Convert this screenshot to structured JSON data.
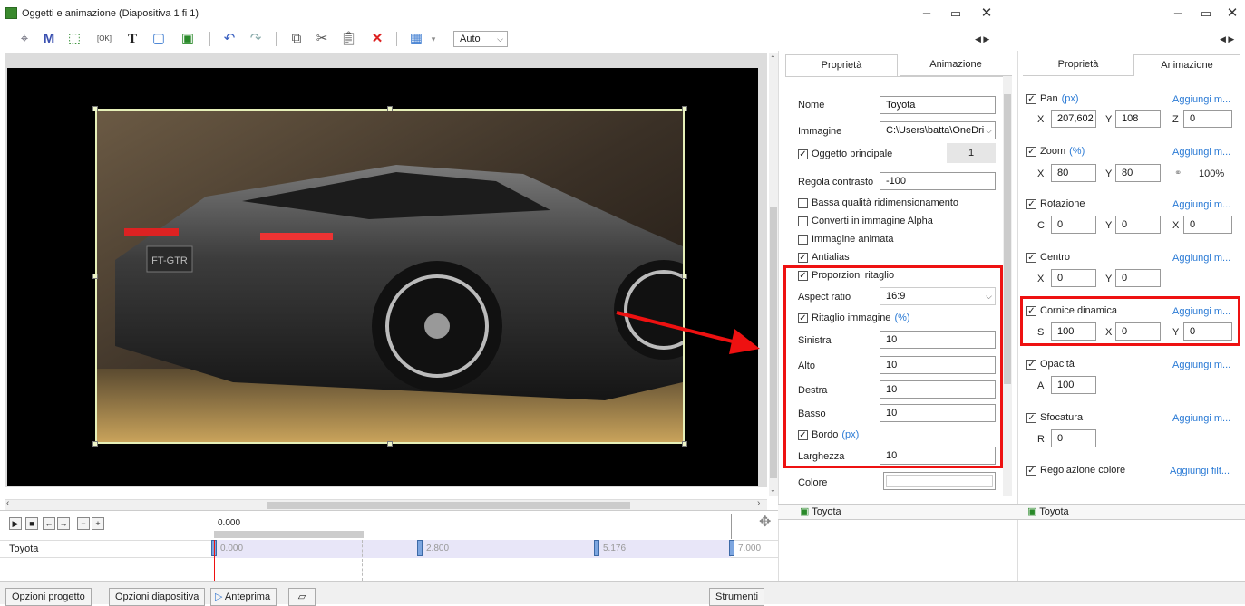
{
  "window": {
    "title": "Oggetti e animazione (Diapositiva 1 fi 1)"
  },
  "toolbar": {
    "zoom": "Auto"
  },
  "left_panel": {
    "tabs": [
      "Proprietà",
      "Animazione"
    ],
    "nome_label": "Nome",
    "nome_value": "Toyota",
    "immagine_label": "Immagine",
    "immagine_value": "C:\\Users\\batta\\OneDri",
    "oggetto_principale": "Oggetto principale",
    "oggetto_value": "1",
    "contrasto_label": "Regola contrasto",
    "contrasto_value": "-100",
    "bassa_qualita": "Bassa qualità ridimensionamento",
    "converti_alpha": "Converti in immagine Alpha",
    "immagine_animata": "Immagine animata",
    "antialias": "Antialias",
    "proporzioni": "Proporzioni ritaglio",
    "aspect_label": "Aspect ratio",
    "aspect_value": "16:9",
    "ritaglio_label": "Ritaglio immagine",
    "ritaglio_unit": "(%)",
    "sinistra_label": "Sinistra",
    "sinistra_value": "10",
    "alto_label": "Alto",
    "alto_value": "10",
    "destra_label": "Destra",
    "destra_value": "10",
    "basso_label": "Basso",
    "basso_value": "10",
    "bordo_label": "Bordo",
    "bordo_unit": "(px)",
    "larghezza_label": "Larghezza",
    "larghezza_value": "10",
    "colore_label": "Colore",
    "object_name": "Toyota"
  },
  "right_panel": {
    "tabs": [
      "Proprietà",
      "Animazione"
    ],
    "add_label": "Aggiungi m...",
    "add_filter": "Aggiungi filt...",
    "pan": "Pan",
    "pan_unit": "(px)",
    "pan_x": "207,602",
    "pan_y": "108",
    "pan_z": "0",
    "zoom": "Zoom",
    "zoom_unit": "(%)",
    "zoom_x": "80",
    "zoom_y": "80",
    "zoom_pct": "100%",
    "rotazione": "Rotazione",
    "rot_c": "0",
    "rot_y": "0",
    "rot_x": "0",
    "centro": "Centro",
    "centro_x": "0",
    "centro_y": "0",
    "cornice": "Cornice dinamica",
    "cornice_s": "100",
    "cornice_x": "0",
    "cornice_y": "0",
    "opacita": "Opacità",
    "opacita_a": "100",
    "sfocatura": "Sfocatura",
    "sfocatura_r": "0",
    "regolazione": "Regolazione colore",
    "object_name": "Toyota",
    "letters": {
      "x": "X",
      "y": "Y",
      "z": "Z",
      "c": "C",
      "s": "S",
      "a": "A",
      "r": "R"
    }
  },
  "timeline": {
    "time": "0.000",
    "track": "Toyota",
    "marks": [
      "0.000",
      "2.800",
      "5.176",
      "7.000"
    ]
  },
  "bottom": {
    "opzioni_progetto": "Opzioni progetto",
    "opzioni_diapositiva": "Opzioni diapositiva",
    "anteprima": "Anteprima",
    "strumenti": "Strumenti"
  },
  "photo_text": {
    "plate": "FT-GTR"
  },
  "colors": {
    "red_highlight": "#e11111",
    "accent": "#2a7ad5"
  }
}
